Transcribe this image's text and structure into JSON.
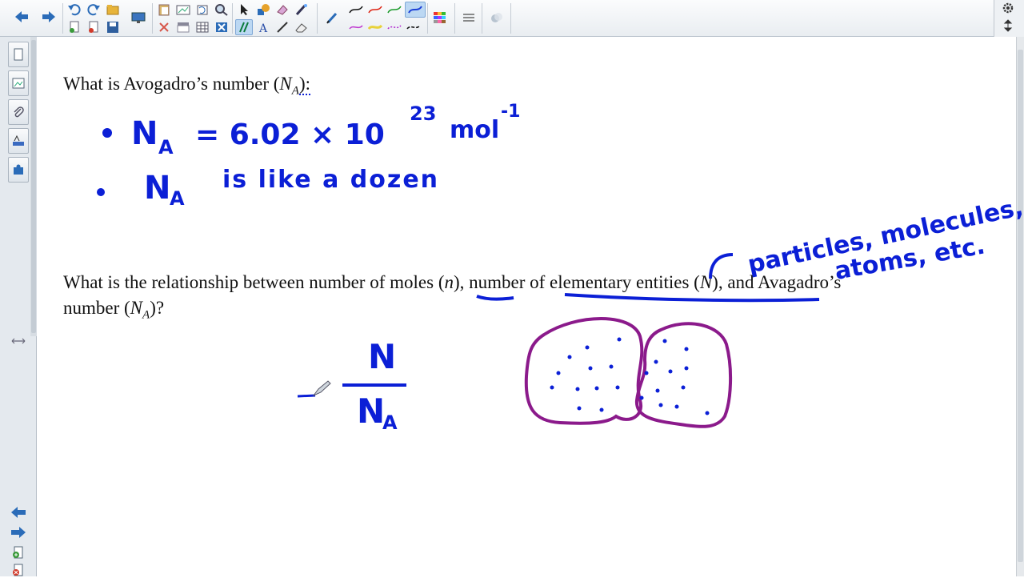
{
  "toolbar": {
    "buttons": [
      "back",
      "forward",
      "undo",
      "redo",
      "open",
      "screen",
      "insert",
      "delete",
      "select",
      "pen",
      "text",
      "line",
      "eraser",
      "fill",
      "properties",
      "more"
    ]
  },
  "content": {
    "q1": {
      "prefix": "What is Avogadro’s number (",
      "symbol_main": "N",
      "symbol_sub": "A",
      "suffix": "):"
    },
    "q2": {
      "line1_a": "What is the relationship between number of moles (",
      "var_n": "n",
      "line1_b": "), number of elementary entities (",
      "var_N": "N",
      "line1_c": "), and Avagadro’s",
      "line2_a": "number (",
      "sym_main": "N",
      "sym_sub": "A",
      "line2_b": ")?"
    },
    "handwriting": {
      "bullet1_lhs": "N",
      "bullet1_sub": "A",
      "bullet1_rhs": "= 6.02 × 10",
      "bullet1_exp": "23",
      "bullet1_unit": "mol",
      "bullet1_unit_exp": "-1",
      "bullet2_lhs": "N",
      "bullet2_sub": "A",
      "bullet2_rest": "is like a dozen",
      "note_line1": "particles, molecules,",
      "note_line2": "atoms, etc.",
      "fraction_num": "N",
      "fraction_den": "N",
      "fraction_den_sub": "A"
    }
  },
  "colors": {
    "ink_blue": "#0b1fd6",
    "ink_purple": "#8b1a8b",
    "toolbar_bg": "#e9edf1",
    "sidebar_bg": "#e4e9ee"
  }
}
